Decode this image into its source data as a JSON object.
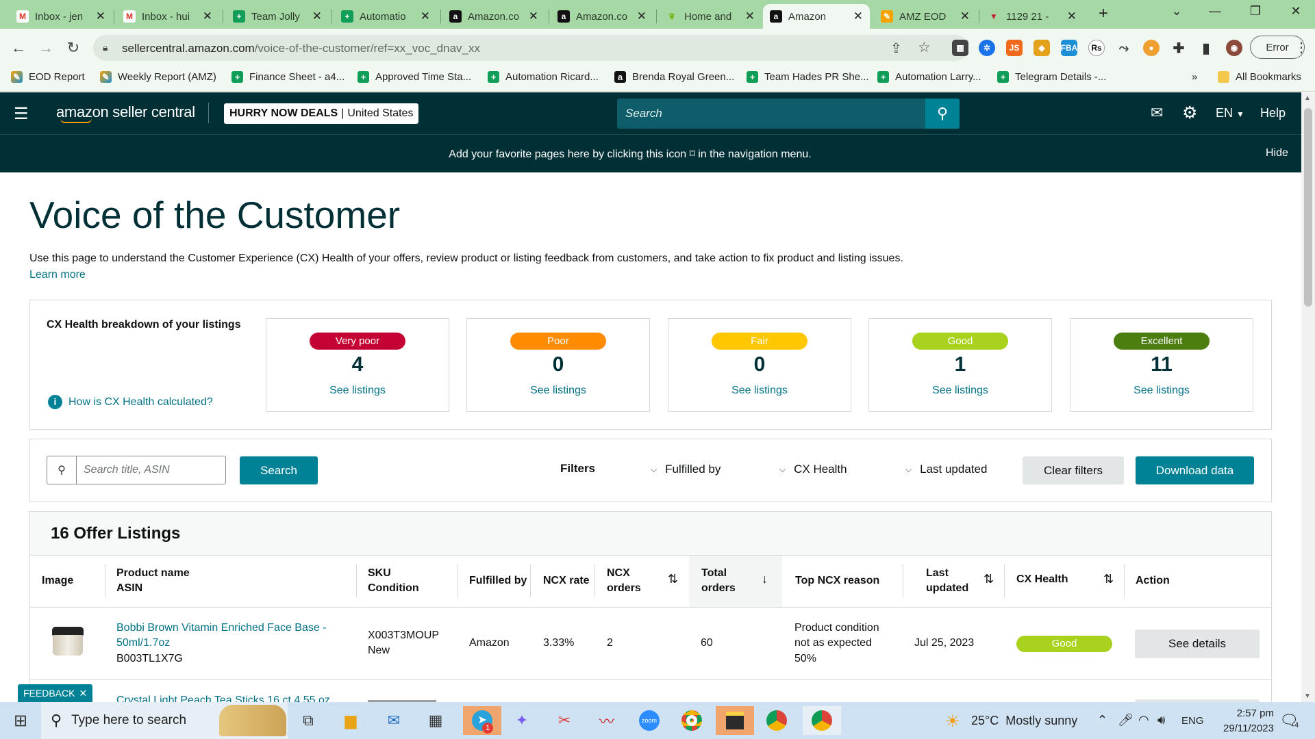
{
  "browser": {
    "tabs": [
      {
        "title": "Inbox - jen",
        "icon": "gmail-icon"
      },
      {
        "title": "Inbox - hui",
        "icon": "gmail-icon"
      },
      {
        "title": "Team Jolly",
        "icon": "sheets-icon"
      },
      {
        "title": "Automatio",
        "icon": "sheets-icon"
      },
      {
        "title": "Amazon.co",
        "icon": "amazon-icon"
      },
      {
        "title": "Amazon.co",
        "icon": "amazon-icon"
      },
      {
        "title": "Home and",
        "icon": "leaf-icon"
      },
      {
        "title": "Amazon",
        "icon": "amazon-icon",
        "active": true
      },
      {
        "title": "AMZ EOD",
        "icon": "pencil-icon"
      },
      {
        "title": "1129 21 -",
        "icon": "shield-icon"
      }
    ],
    "url_host": "sellercentral.amazon.com",
    "url_path": "/voice-of-the-customer/ref=xx_voc_dnav_xx",
    "error_label": "Error",
    "bookmarks": [
      "EOD Report",
      "Weekly Report (AMZ)",
      "Finance Sheet - a4...",
      "Approved Time Sta...",
      "Automation Ricard...",
      "Brenda Royal Green...",
      "Team Hades PR She...",
      "Automation Larry...",
      "Telegram Details -..."
    ],
    "bookmarks_more": "»",
    "all_bookmarks": "All Bookmarks"
  },
  "header": {
    "logo_text": "amazon seller central",
    "store_name": "HURRY NOW DEALS",
    "marketplace": "United States",
    "search_placeholder": "Search",
    "language": "EN",
    "help": "Help",
    "notice": "Add your favorite pages here by clicking this icon ⌑ in the navigation menu.",
    "hide": "Hide"
  },
  "page": {
    "title": "Voice of the Customer",
    "intro": "Use this page to understand the Customer Experience (CX) Health of your offers, review product or listing feedback from customers, and take action to fix product and listing issues.",
    "learn_more": "Learn more",
    "breakdown_title": "CX Health breakdown of your listings",
    "how_calc": "How is CX Health calculated?",
    "cards": [
      {
        "label": "Very poor",
        "count": "4",
        "link": "See listings",
        "color": "#c40233"
      },
      {
        "label": "Poor",
        "count": "0",
        "link": "See listings",
        "color": "#ff8c00"
      },
      {
        "label": "Fair",
        "count": "0",
        "link": "See listings",
        "color": "#ffc700"
      },
      {
        "label": "Good",
        "count": "1",
        "link": "See listings",
        "color": "#a9d21e"
      },
      {
        "label": "Excellent",
        "count": "11",
        "link": "See listings",
        "color": "#4b7d0f"
      }
    ],
    "search_placeholder": "Search title, ASIN",
    "search_button": "Search",
    "filters_label": "Filters",
    "filters": [
      "Fulfilled by",
      "CX Health",
      "Last updated"
    ],
    "clear_filters": "Clear filters",
    "download": "Download data",
    "listings_title": "16 Offer Listings",
    "columns": {
      "image": "Image",
      "product": "Product name",
      "asin": "ASIN",
      "sku": "SKU",
      "condition": "Condition",
      "fulfilled": "Fulfilled by",
      "ncx_rate": "NCX rate",
      "ncx_orders_1": "NCX",
      "ncx_orders_2": "orders",
      "total_1": "Total",
      "total_2": "orders",
      "reason": "Top NCX reason",
      "updated_1": "Last",
      "updated_2": "updated",
      "cx": "CX Health",
      "action": "Action"
    },
    "rows": [
      {
        "product_1": "Bobbi Brown Vitamin Enriched Face Base -",
        "product_2": "50ml/1.7oz",
        "asin": "B003TL1X7G",
        "sku": "X003T3MOUP",
        "condition": "New",
        "fulfilled": "Amazon",
        "ncx_rate": "3.33%",
        "ncx_orders": "2",
        "total_orders": "60",
        "reason_1": "Product condition",
        "reason_2": "not as expected",
        "reason_3": "50%",
        "updated": "Jul 25, 2023",
        "cx": "Good",
        "action": "See details"
      },
      {
        "product_1": "Crystal Light Peach Tea Sticks 16 ct 4.55 oz"
      }
    ],
    "feedback": "FEEDBACK"
  },
  "taskbar": {
    "search_placeholder": "Type here to search",
    "weather": "25°C  Mostly sunny",
    "language": "ENG",
    "time": "2:57 pm",
    "date": "29/11/2023",
    "notifications": "4",
    "telegram_badge": "1"
  }
}
